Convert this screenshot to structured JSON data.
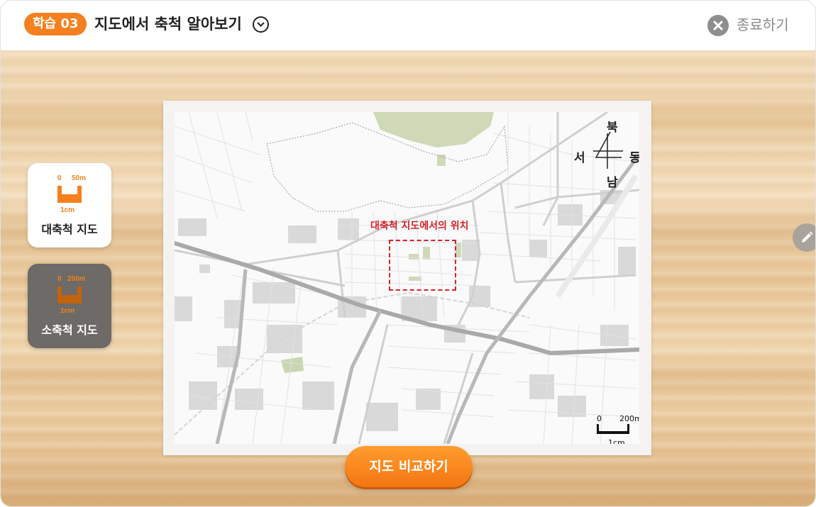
{
  "header": {
    "badge": "학습 03",
    "title": "지도에서 축척 알아보기",
    "exit_label": "종료하기"
  },
  "scale_cards": [
    {
      "label": "대축척 지도",
      "scale_zero": "0",
      "scale_value": "50m",
      "unit_length": "1cm",
      "selected": true
    },
    {
      "label": "소축척 지도",
      "scale_zero": "0",
      "scale_value": "200m",
      "unit_length": "1cm",
      "selected": false
    }
  ],
  "map": {
    "compass": {
      "north": "북",
      "south": "남",
      "west": "서",
      "east": "동"
    },
    "area_label": "대축척 지도에서의 위치",
    "scale_bar": {
      "zero": "0",
      "value": "200m",
      "unit_length": "1cm"
    }
  },
  "actions": {
    "compare_label": "지도 비교하기"
  },
  "colors": {
    "accent": "#f4801f",
    "area_marker": "#d6222b",
    "selected_card": "#ffffff",
    "unselected_card": "#6d6a67"
  },
  "icons": {
    "title_toggle": "chevron-down-circle-icon",
    "exit": "close-circle-icon",
    "pen": "pencil-icon"
  }
}
